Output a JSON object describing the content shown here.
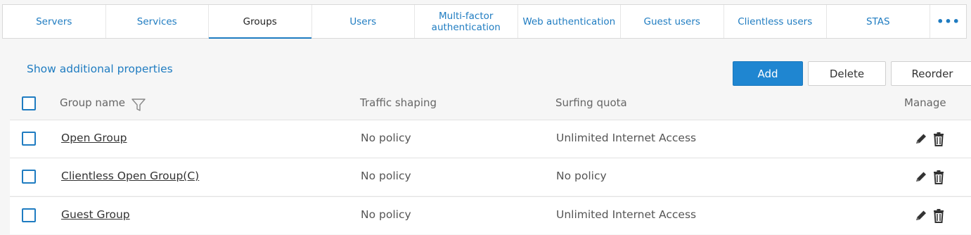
{
  "tabs": [
    {
      "label": "Servers",
      "active": false
    },
    {
      "label": "Services",
      "active": false
    },
    {
      "label": "Groups",
      "active": true
    },
    {
      "label": "Users",
      "active": false
    },
    {
      "label": "Multi-factor authentication",
      "active": false
    },
    {
      "label": "Web authentication",
      "active": false
    },
    {
      "label": "Guest users",
      "active": false
    },
    {
      "label": "Clientless users",
      "active": false
    },
    {
      "label": "STAS",
      "active": false
    }
  ],
  "more_tabs_label": "•••",
  "toolbar": {
    "show_props_label": "Show additional properties",
    "add_label": "Add",
    "delete_label": "Delete",
    "reorder_label": "Reorder"
  },
  "table": {
    "headers": {
      "name": "Group name",
      "traffic": "Traffic shaping",
      "quota": "Surfing quota",
      "manage": "Manage"
    },
    "rows": [
      {
        "name": "Open Group",
        "traffic": "No policy",
        "quota": "Unlimited Internet Access"
      },
      {
        "name": "Clientless Open Group(C)",
        "traffic": "No policy",
        "quota": "No policy"
      },
      {
        "name": "Guest Group",
        "traffic": "No policy",
        "quota": "Unlimited Internet Access"
      }
    ]
  },
  "icons": {
    "filter": "filter-icon",
    "edit": "pencil-icon",
    "delete": "trash-icon",
    "more": "more-icon"
  },
  "colors": {
    "accent": "#1f7cc1",
    "primary_button": "#1f86d1",
    "background": "#f6f6f6"
  }
}
